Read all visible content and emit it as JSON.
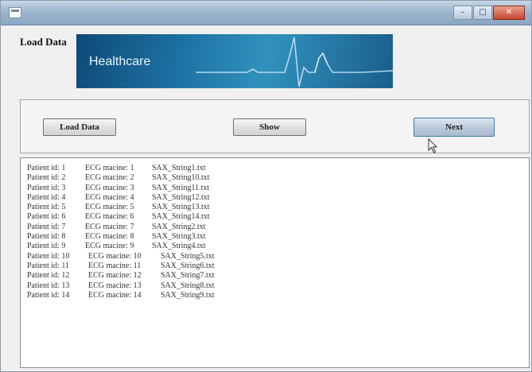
{
  "header": {
    "heading": "Load Data"
  },
  "banner": {
    "text": "Healthcare"
  },
  "toolbar": {
    "load_label": "Load Data",
    "show_label": "Show",
    "next_label": "Next"
  },
  "records": [
    {
      "patient": "Patient id: 1",
      "ecg": "ECG macine: 1",
      "file": "SAX_String1.txt"
    },
    {
      "patient": "Patient id: 2",
      "ecg": "ECG macine: 2",
      "file": "SAX_String10.txt"
    },
    {
      "patient": "Patient id: 3",
      "ecg": "ECG macine: 3",
      "file": "SAX_String11.txt"
    },
    {
      "patient": "Patient id: 4",
      "ecg": "ECG macine: 4",
      "file": "SAX_String12.txt"
    },
    {
      "patient": "Patient id: 5",
      "ecg": "ECG macine: 5",
      "file": "SAX_String13.txt"
    },
    {
      "patient": "Patient id: 6",
      "ecg": "ECG macine: 6",
      "file": "SAX_String14.txt"
    },
    {
      "patient": "Patient id: 7",
      "ecg": "ECG macine: 7",
      "file": "SAX_String2.txt"
    },
    {
      "patient": "Patient id: 8",
      "ecg": "ECG macine: 8",
      "file": "SAX_String3.txt"
    },
    {
      "patient": "Patient id: 9",
      "ecg": "ECG macine: 9",
      "file": "SAX_String4.txt"
    },
    {
      "patient": "Patient id: 10",
      "ecg": "ECG macine: 10",
      "file": "SAX_String5.txt"
    },
    {
      "patient": "Patient id: 11",
      "ecg": "ECG macine: 11",
      "file": "SAX_String6.txt"
    },
    {
      "patient": "Patient id: 12",
      "ecg": "ECG macine: 12",
      "file": "SAX_String7.txt"
    },
    {
      "patient": "Patient id: 13",
      "ecg": "ECG macine: 13",
      "file": "SAX_String8.txt"
    },
    {
      "patient": "Patient id: 14",
      "ecg": "ECG macine: 14",
      "file": "SAX_String9.txt"
    }
  ]
}
